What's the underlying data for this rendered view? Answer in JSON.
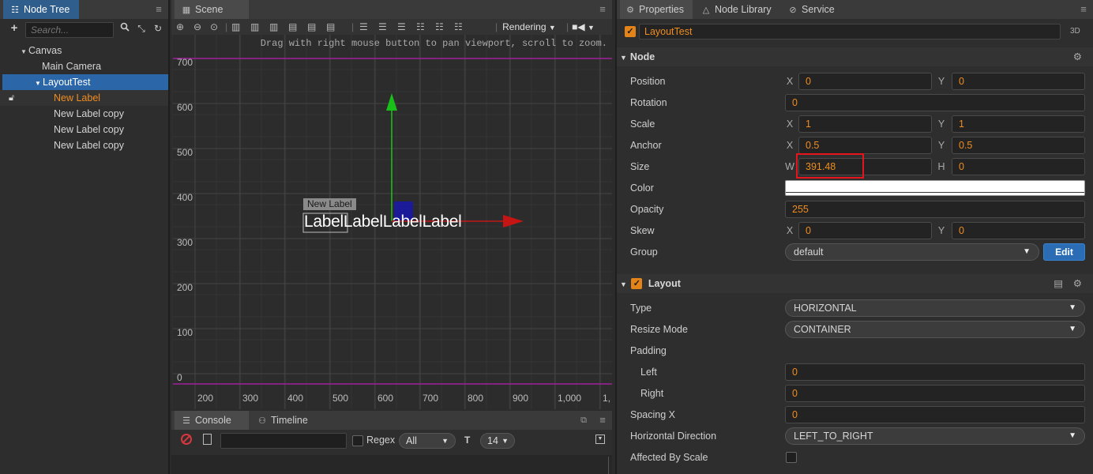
{
  "node_tree": {
    "tab_label": "Node Tree",
    "search_placeholder": "Search...",
    "items": [
      {
        "label": "Canvas"
      },
      {
        "label": "Main Camera"
      },
      {
        "label": "LayoutTest"
      },
      {
        "label": "New Label"
      },
      {
        "label": "New Label copy"
      },
      {
        "label": "New Label copy"
      },
      {
        "label": "New Label copy"
      }
    ]
  },
  "scene": {
    "tab_label": "Scene",
    "rendering_label": "Rendering",
    "hint": "Drag with right mouse button to pan viewport, scroll to zoom.",
    "y_ticks": [
      "700",
      "600",
      "500",
      "400",
      "300",
      "200",
      "100",
      "0"
    ],
    "x_ticks": [
      "200",
      "300",
      "400",
      "500",
      "600",
      "700",
      "800",
      "900",
      "1,000",
      "1,"
    ],
    "node_tag": "New Label",
    "label_text": "LabelLabelLabelLabel"
  },
  "console": {
    "tab_console": "Console",
    "tab_timeline": "Timeline",
    "regex_label": "Regex",
    "filter_value": "All",
    "font_size": "14"
  },
  "properties": {
    "tabs": [
      {
        "label": "Properties"
      },
      {
        "label": "Node Library"
      },
      {
        "label": "Service"
      }
    ],
    "node_name": "LayoutTest",
    "mode_3d": "3D",
    "node_section": "Node",
    "position_label": "Position",
    "position_x": "0",
    "position_y": "0",
    "rotation_label": "Rotation",
    "rotation": "0",
    "scale_label": "Scale",
    "scale_x": "1",
    "scale_y": "1",
    "anchor_label": "Anchor",
    "anchor_x": "0.5",
    "anchor_y": "0.5",
    "size_label": "Size",
    "size_w": "391.48",
    "size_h": "0",
    "color_label": "Color",
    "color_value": "#ffffff",
    "opacity_label": "Opacity",
    "opacity": "255",
    "skew_label": "Skew",
    "skew_x": "0",
    "skew_y": "0",
    "group_label": "Group",
    "group_value": "default",
    "edit_label": "Edit",
    "layout_section": "Layout",
    "type_label": "Type",
    "type_value": "HORIZONTAL",
    "resize_label": "Resize Mode",
    "resize_value": "CONTAINER",
    "padding_label": "Padding",
    "left_label": "Left",
    "left_value": "0",
    "right_label": "Right",
    "right_value": "0",
    "spacing_label": "Spacing X",
    "spacing_value": "0",
    "hdir_label": "Horizontal Direction",
    "hdir_value": "LEFT_TO_RIGHT",
    "affected_label": "Affected By Scale",
    "letters": {
      "x": "X",
      "y": "Y",
      "w": "W",
      "h": "H"
    }
  },
  "colors": {
    "accent_orange": "#f08d1e",
    "selection_blue": "#2a66a8",
    "highlight_red": "#e5151b"
  }
}
